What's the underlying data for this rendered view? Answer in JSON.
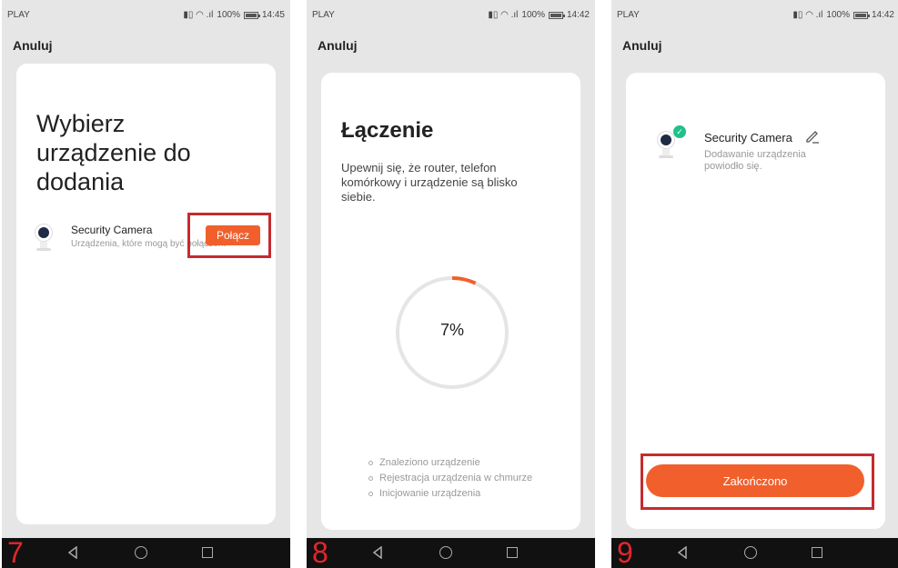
{
  "status_bar": {
    "carrier": "PLAY",
    "battery": "100%"
  },
  "screens": [
    {
      "time": "14:45",
      "cancel": "Anuluj",
      "title": "Wybierz urządzenie do dodania",
      "device_name": "Security Camera",
      "device_sub": "Urządzenia, które mogą być połączone",
      "connect_label": "Połącz",
      "step_number": "7"
    },
    {
      "time": "14:42",
      "cancel": "Anuluj",
      "title": "Łączenie",
      "description": "Upewnij się, że router, telefon komórkowy i urządzenie są blisko siebie.",
      "progress_percent": "7%",
      "progress_value": 7,
      "steps": [
        "Znaleziono urządzenie",
        "Rejestracja urządzenia w chmurze",
        "Inicjowanie urządzenia"
      ],
      "step_number": "8"
    },
    {
      "time": "14:42",
      "cancel": "Anuluj",
      "device_name": "Security Camera",
      "device_status": "Dodawanie urządzenia powiodło się.",
      "finish_label": "Zakończono",
      "step_number": "9"
    }
  ],
  "colors": {
    "accent": "#f1602c",
    "highlight_box": "#c52b2f",
    "success": "#20c08a",
    "step_number": "#e3262b"
  },
  "icons": [
    "back-icon",
    "home-icon",
    "recent-apps-icon",
    "camera-icon",
    "check-icon",
    "edit-pencil-icon"
  ]
}
